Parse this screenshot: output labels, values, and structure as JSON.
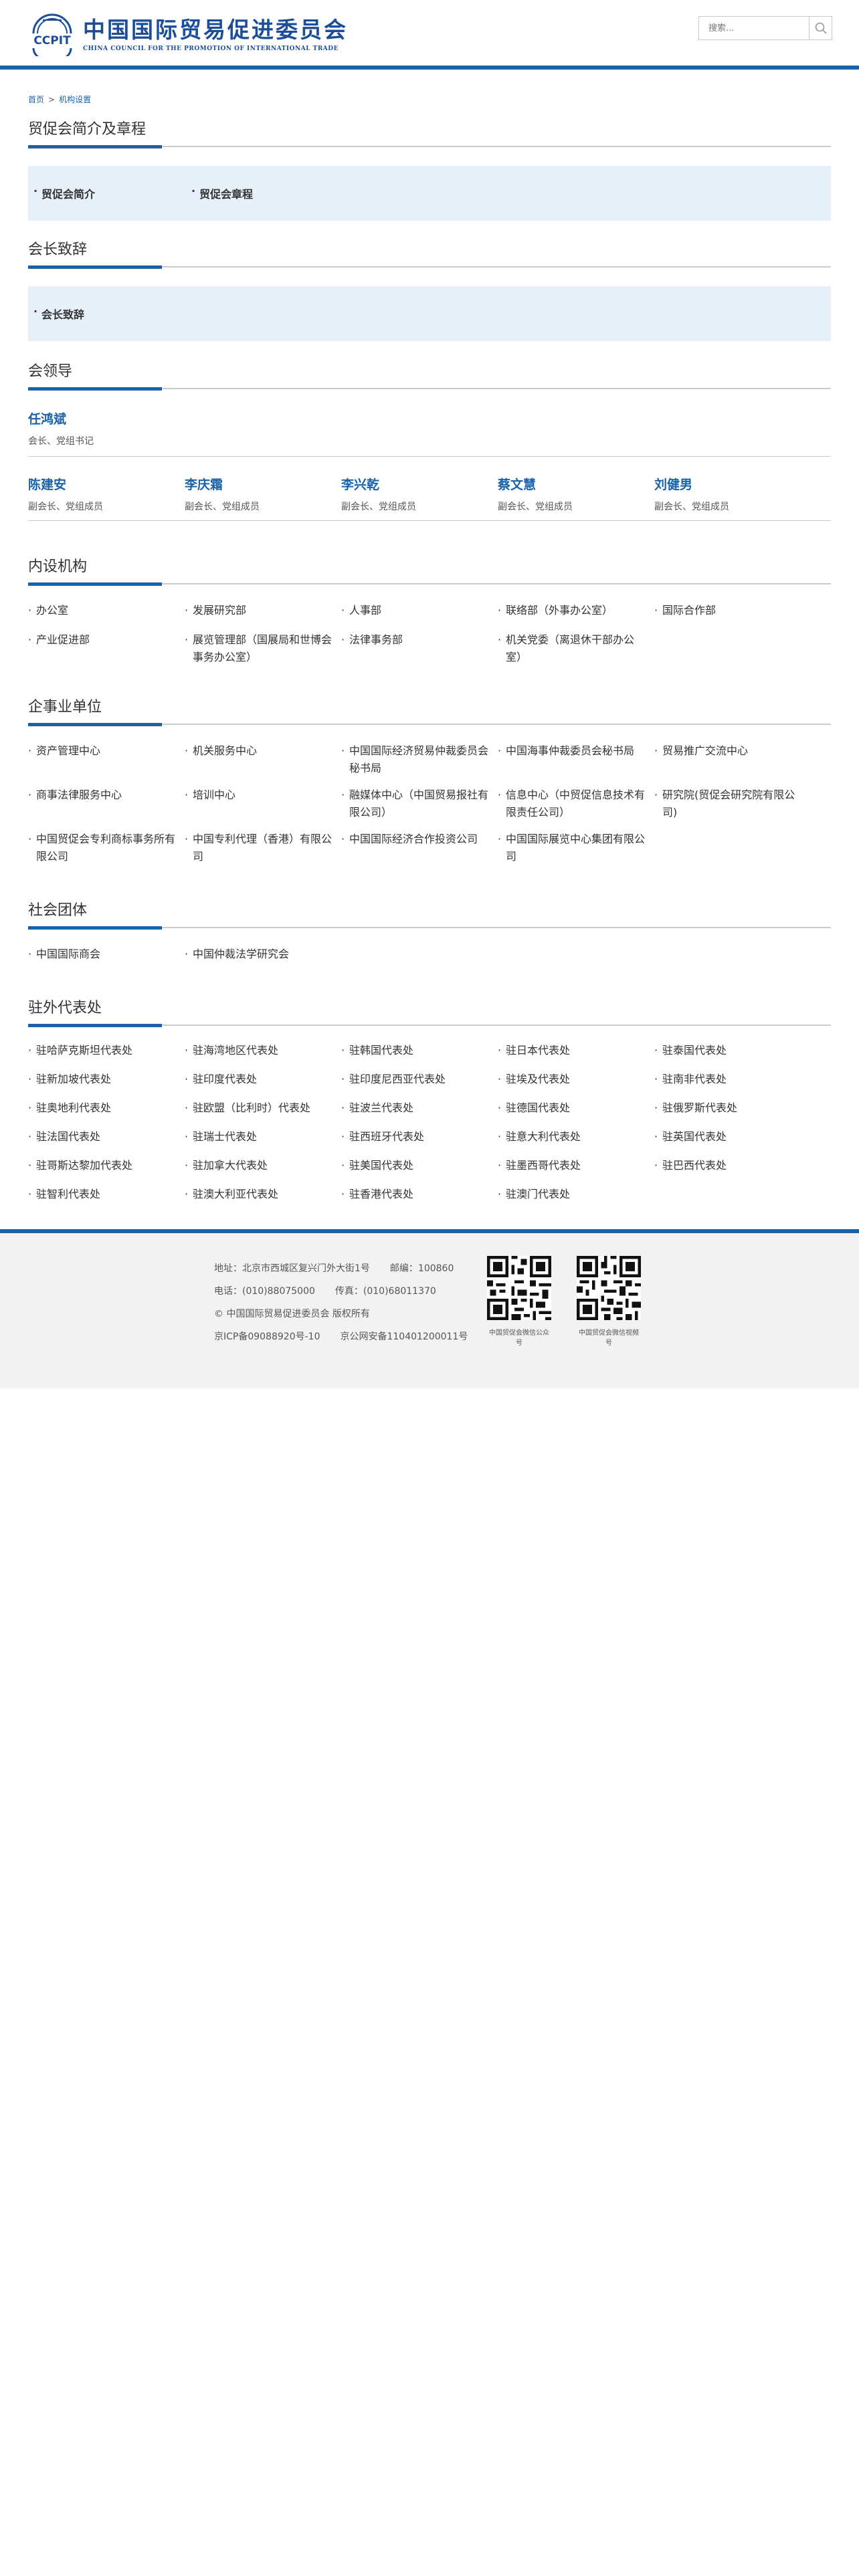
{
  "header": {
    "logo_cn": "中国国际贸易促进委员会",
    "logo_en": "CHINA COUNCIL FOR THE PROMOTION OF INTERNATIONAL TRADE",
    "logo_mark": "CCPIT",
    "search_placeholder": "搜索..."
  },
  "breadcrumb": {
    "home": "首页",
    "separator": ">",
    "current": "机构设置"
  },
  "sections": {
    "intro": {
      "title": "贸促会简介及章程",
      "links": [
        "贸促会简介",
        "贸促会章程"
      ]
    },
    "speech": {
      "title": "会长致辞",
      "links": [
        "会长致辞"
      ]
    },
    "leadership": {
      "title": "会领导",
      "head": {
        "name": "任鸿斌",
        "title": "会长、党组书记"
      },
      "members": [
        {
          "name": "陈建安",
          "title": "副会长、党组成员"
        },
        {
          "name": "李庆霜",
          "title": "副会长、党组成员"
        },
        {
          "name": "李兴乾",
          "title": "副会长、党组成员"
        },
        {
          "name": "蔡文慧",
          "title": "副会长、党组成员"
        },
        {
          "name": "刘健男",
          "title": "副会长、党组成员"
        }
      ]
    },
    "internal": {
      "title": "内设机构",
      "items": [
        "办公室",
        "发展研究部",
        "人事部",
        "联络部（外事办公室）",
        "国际合作部",
        "产业促进部",
        "展览管理部（国展局和世博会事务办公室）",
        "法律事务部",
        "机关党委（离退休干部办公室）"
      ]
    },
    "enterprises": {
      "title": "企事业单位",
      "items": [
        "资产管理中心",
        "机关服务中心",
        "中国国际经济贸易仲裁委员会秘书局",
        "中国海事仲裁委员会秘书局",
        "贸易推广交流中心",
        "商事法律服务中心",
        "培训中心",
        "融媒体中心（中国贸易报社有限公司）",
        "信息中心（中贸促信息技术有限责任公司）",
        "研究院(贸促会研究院有限公司)",
        "中国贸促会专利商标事务所有限公司",
        "中国专利代理（香港）有限公司",
        "中国国际经济合作投资公司",
        "中国国际展览中心集团有限公司"
      ]
    },
    "social": {
      "title": "社会团体",
      "items": [
        "中国国际商会",
        "中国仲裁法学研究会"
      ]
    },
    "overseas": {
      "title": "驻外代表处",
      "items": [
        "驻哈萨克斯坦代表处",
        "驻海湾地区代表处",
        "驻韩国代表处",
        "驻日本代表处",
        "驻泰国代表处",
        "驻新加坡代表处",
        "驻印度代表处",
        "驻印度尼西亚代表处",
        "驻埃及代表处",
        "驻南非代表处",
        "驻奥地利代表处",
        "驻欧盟（比利时）代表处",
        "驻波兰代表处",
        "驻德国代表处",
        "驻俄罗斯代表处",
        "驻法国代表处",
        "驻瑞士代表处",
        "驻西班牙代表处",
        "驻意大利代表处",
        "驻英国代表处",
        "驻哥斯达黎加代表处",
        "驻加拿大代表处",
        "驻美国代表处",
        "驻墨西哥代表处",
        "驻巴西代表处",
        "驻智利代表处",
        "驻澳大利亚代表处",
        "驻香港代表处",
        "驻澳门代表处"
      ]
    }
  },
  "footer": {
    "address": "地址：北京市西城区复兴门外大街1号",
    "postcode": "邮编：100860",
    "phone": "电话：(010)88075000",
    "fax": "传真：(010)68011370",
    "copyright": "© 中国国际贸易促进委员会 版权所有",
    "icp": "京ICP备09088920号-10",
    "police": "京公网安备110401200011号",
    "qr_labels": [
      "中国贸促会微信公众号",
      "中国贸促会微信视频号"
    ]
  },
  "colors": {
    "brand": "#1a62a8",
    "box_bg": "#e7f0f8",
    "footer_bg": "#f2f2f2"
  }
}
